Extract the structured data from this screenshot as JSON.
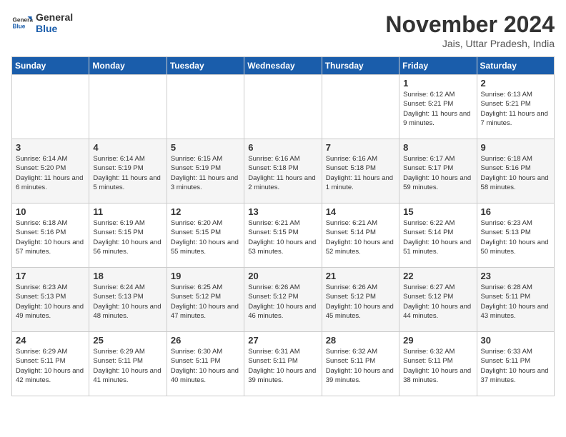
{
  "logo": {
    "general": "General",
    "blue": "Blue"
  },
  "title": "November 2024",
  "location": "Jais, Uttar Pradesh, India",
  "days_of_week": [
    "Sunday",
    "Monday",
    "Tuesday",
    "Wednesday",
    "Thursday",
    "Friday",
    "Saturday"
  ],
  "weeks": [
    [
      {
        "day": "",
        "info": ""
      },
      {
        "day": "",
        "info": ""
      },
      {
        "day": "",
        "info": ""
      },
      {
        "day": "",
        "info": ""
      },
      {
        "day": "",
        "info": ""
      },
      {
        "day": "1",
        "info": "Sunrise: 6:12 AM\nSunset: 5:21 PM\nDaylight: 11 hours and 9 minutes."
      },
      {
        "day": "2",
        "info": "Sunrise: 6:13 AM\nSunset: 5:21 PM\nDaylight: 11 hours and 7 minutes."
      }
    ],
    [
      {
        "day": "3",
        "info": "Sunrise: 6:14 AM\nSunset: 5:20 PM\nDaylight: 11 hours and 6 minutes."
      },
      {
        "day": "4",
        "info": "Sunrise: 6:14 AM\nSunset: 5:19 PM\nDaylight: 11 hours and 5 minutes."
      },
      {
        "day": "5",
        "info": "Sunrise: 6:15 AM\nSunset: 5:19 PM\nDaylight: 11 hours and 3 minutes."
      },
      {
        "day": "6",
        "info": "Sunrise: 6:16 AM\nSunset: 5:18 PM\nDaylight: 11 hours and 2 minutes."
      },
      {
        "day": "7",
        "info": "Sunrise: 6:16 AM\nSunset: 5:18 PM\nDaylight: 11 hours and 1 minute."
      },
      {
        "day": "8",
        "info": "Sunrise: 6:17 AM\nSunset: 5:17 PM\nDaylight: 10 hours and 59 minutes."
      },
      {
        "day": "9",
        "info": "Sunrise: 6:18 AM\nSunset: 5:16 PM\nDaylight: 10 hours and 58 minutes."
      }
    ],
    [
      {
        "day": "10",
        "info": "Sunrise: 6:18 AM\nSunset: 5:16 PM\nDaylight: 10 hours and 57 minutes."
      },
      {
        "day": "11",
        "info": "Sunrise: 6:19 AM\nSunset: 5:15 PM\nDaylight: 10 hours and 56 minutes."
      },
      {
        "day": "12",
        "info": "Sunrise: 6:20 AM\nSunset: 5:15 PM\nDaylight: 10 hours and 55 minutes."
      },
      {
        "day": "13",
        "info": "Sunrise: 6:21 AM\nSunset: 5:15 PM\nDaylight: 10 hours and 53 minutes."
      },
      {
        "day": "14",
        "info": "Sunrise: 6:21 AM\nSunset: 5:14 PM\nDaylight: 10 hours and 52 minutes."
      },
      {
        "day": "15",
        "info": "Sunrise: 6:22 AM\nSunset: 5:14 PM\nDaylight: 10 hours and 51 minutes."
      },
      {
        "day": "16",
        "info": "Sunrise: 6:23 AM\nSunset: 5:13 PM\nDaylight: 10 hours and 50 minutes."
      }
    ],
    [
      {
        "day": "17",
        "info": "Sunrise: 6:23 AM\nSunset: 5:13 PM\nDaylight: 10 hours and 49 minutes."
      },
      {
        "day": "18",
        "info": "Sunrise: 6:24 AM\nSunset: 5:13 PM\nDaylight: 10 hours and 48 minutes."
      },
      {
        "day": "19",
        "info": "Sunrise: 6:25 AM\nSunset: 5:12 PM\nDaylight: 10 hours and 47 minutes."
      },
      {
        "day": "20",
        "info": "Sunrise: 6:26 AM\nSunset: 5:12 PM\nDaylight: 10 hours and 46 minutes."
      },
      {
        "day": "21",
        "info": "Sunrise: 6:26 AM\nSunset: 5:12 PM\nDaylight: 10 hours and 45 minutes."
      },
      {
        "day": "22",
        "info": "Sunrise: 6:27 AM\nSunset: 5:12 PM\nDaylight: 10 hours and 44 minutes."
      },
      {
        "day": "23",
        "info": "Sunrise: 6:28 AM\nSunset: 5:11 PM\nDaylight: 10 hours and 43 minutes."
      }
    ],
    [
      {
        "day": "24",
        "info": "Sunrise: 6:29 AM\nSunset: 5:11 PM\nDaylight: 10 hours and 42 minutes."
      },
      {
        "day": "25",
        "info": "Sunrise: 6:29 AM\nSunset: 5:11 PM\nDaylight: 10 hours and 41 minutes."
      },
      {
        "day": "26",
        "info": "Sunrise: 6:30 AM\nSunset: 5:11 PM\nDaylight: 10 hours and 40 minutes."
      },
      {
        "day": "27",
        "info": "Sunrise: 6:31 AM\nSunset: 5:11 PM\nDaylight: 10 hours and 39 minutes."
      },
      {
        "day": "28",
        "info": "Sunrise: 6:32 AM\nSunset: 5:11 PM\nDaylight: 10 hours and 39 minutes."
      },
      {
        "day": "29",
        "info": "Sunrise: 6:32 AM\nSunset: 5:11 PM\nDaylight: 10 hours and 38 minutes."
      },
      {
        "day": "30",
        "info": "Sunrise: 6:33 AM\nSunset: 5:11 PM\nDaylight: 10 hours and 37 minutes."
      }
    ]
  ]
}
